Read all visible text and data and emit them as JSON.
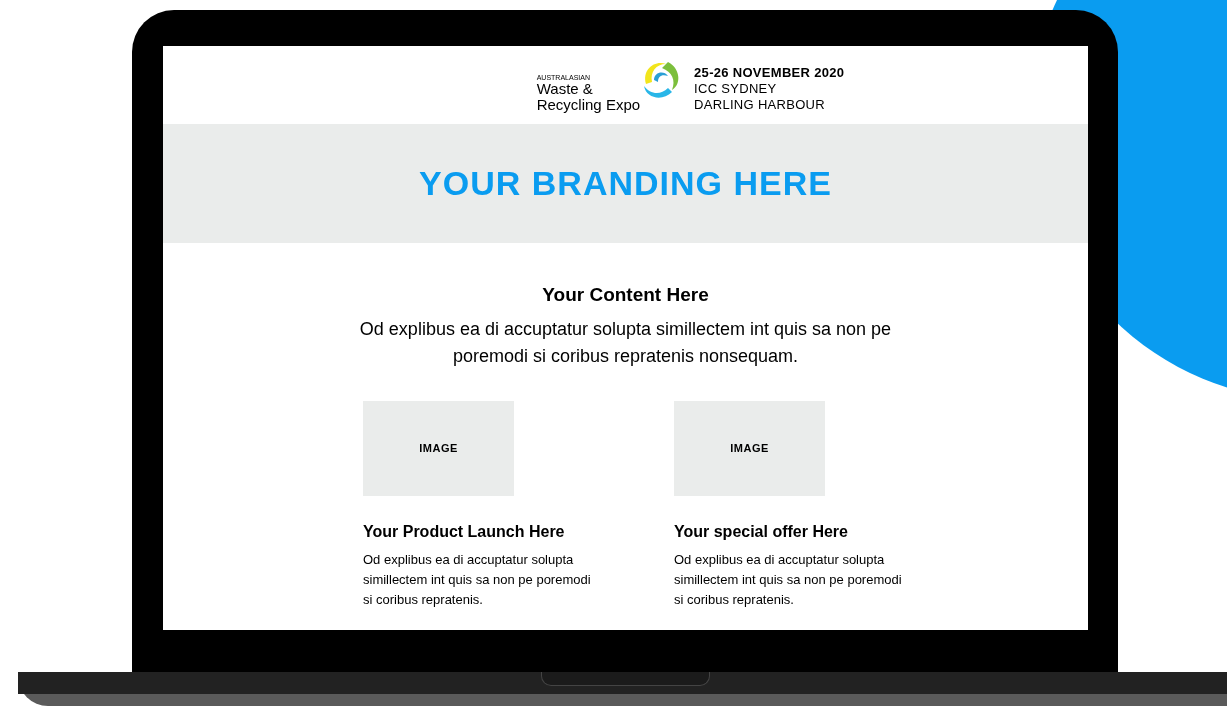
{
  "header": {
    "logo": {
      "region": "AUSTRALASIAN",
      "name_lines": [
        "Waste &",
        "Recycling Expo"
      ]
    },
    "event_lines": [
      {
        "text": "25-26 NOVEMBER 2020",
        "bold": true
      },
      {
        "text": "ICC SYDNEY",
        "bold": false
      },
      {
        "text": "DARLING HARBOUR",
        "bold": false
      }
    ]
  },
  "banner": {
    "title": "YOUR BRANDING HERE"
  },
  "intro": {
    "title": "Your Content Here",
    "text": "Od explibus ea di accuptatur solupta simillectem int quis sa non pe poremodi si coribus repratenis nonsequam."
  },
  "items": [
    {
      "image_label": "IMAGE",
      "title": "Your Product Launch Here",
      "text": "Od explibus ea di accuptatur solupta simillectem int quis sa non pe poremodi si coribus repratenis."
    },
    {
      "image_label": "IMAGE",
      "title": "Your special offer Here",
      "text": "Od explibus ea di accuptatur solupta simillectem int quis sa non pe poremodi si coribus repratenis."
    }
  ]
}
